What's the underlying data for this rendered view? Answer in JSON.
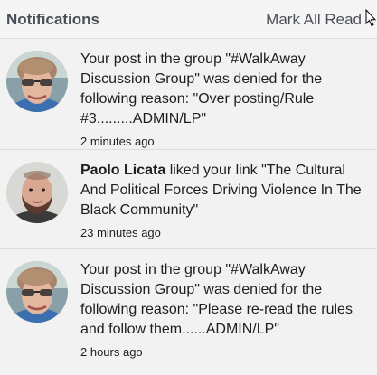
{
  "header": {
    "title": "Notifications",
    "mark_all_label": "Mark All Read"
  },
  "notifications": [
    {
      "avatar": "woman-with-glasses-avatar",
      "actor": "",
      "text": "Your post in the group \"#WalkAway Discussion Group\" was denied for the following reason: \"Over posting/Rule #3.........ADMIN/LP\"",
      "time": "2 minutes ago"
    },
    {
      "avatar": "bearded-man-avatar",
      "actor": "Paolo Licata",
      "text": " liked your link \"The Cultural And Political Forces Driving Violence In The Black Community\"",
      "time": "23 minutes ago"
    },
    {
      "avatar": "woman-with-glasses-avatar",
      "actor": "",
      "text": "Your post in the group \"#WalkAway Discussion Group\" was denied for the following reason: \"Please re-read the rules and follow them......ADMIN/LP\"",
      "time": "2 hours ago"
    }
  ],
  "colors": {
    "background": "#f2f2f2",
    "divider": "#dadde1",
    "header_text": "#4b4f56",
    "body_text": "#1c1e21"
  }
}
